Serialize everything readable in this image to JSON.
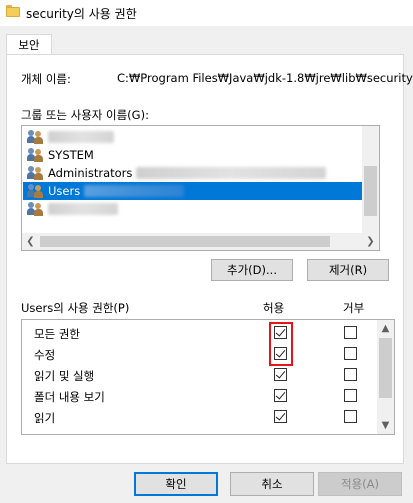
{
  "window": {
    "title": "security의 사용 권한"
  },
  "tabs": [
    {
      "label": "보안"
    }
  ],
  "object": {
    "label": "개체 이름:",
    "value": "C:₩Program Files₩Java₩jdk-1.8₩jre₩lib₩security"
  },
  "groups": {
    "label": "그룹 또는 사용자 이름(G):",
    "items": [
      {
        "name": "",
        "blurred": true,
        "selected": false
      },
      {
        "name": "SYSTEM",
        "blurred": false,
        "selected": false
      },
      {
        "name": "Administrators",
        "blurred": true,
        "selected": false
      },
      {
        "name": "Users",
        "blurred": true,
        "selected": true
      },
      {
        "name": "",
        "blurred": true,
        "selected": false
      }
    ]
  },
  "buttons": {
    "add": "추가(D)...",
    "remove": "제거(R)",
    "ok": "확인",
    "cancel": "취소",
    "apply": "적용(A)"
  },
  "permissions": {
    "label": "Users의 사용 권한(P)",
    "allow_header": "허용",
    "deny_header": "거부",
    "rows": [
      {
        "name": "모든 권한",
        "allow": true,
        "deny": false
      },
      {
        "name": "수정",
        "allow": true,
        "deny": false
      },
      {
        "name": "읽기 및 실행",
        "allow": true,
        "deny": false
      },
      {
        "name": "폴더 내용 보기",
        "allow": true,
        "deny": false
      },
      {
        "name": "읽기",
        "allow": true,
        "deny": false
      }
    ]
  },
  "icons": {
    "folder": "folder-icon",
    "user": "users-icon"
  },
  "colors": {
    "selection": "#0078d7",
    "highlight": "#e8141a"
  }
}
